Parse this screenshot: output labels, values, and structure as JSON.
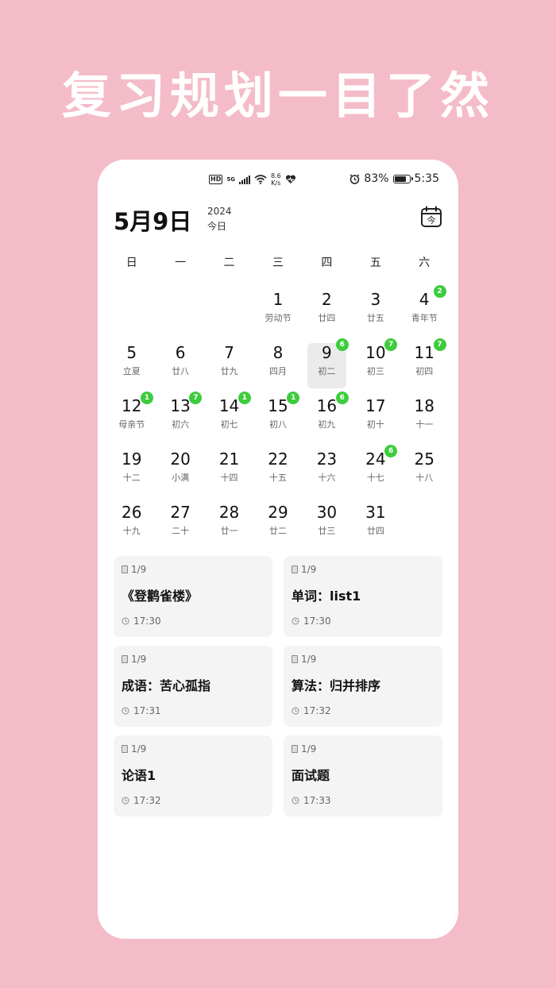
{
  "headline": "复习规划一目了然",
  "status_bar": {
    "hd": "HD",
    "net": "5G",
    "speed_value": "8.6",
    "speed_unit": "K/s",
    "battery_percent": "83%",
    "battery_level": 0.83,
    "time": "5:35"
  },
  "header": {
    "date": "5月9日",
    "year": "2024",
    "today_label": "今日",
    "today_button_glyph": "今"
  },
  "weekdays": [
    "日",
    "一",
    "二",
    "三",
    "四",
    "五",
    "六"
  ],
  "days": [
    {
      "num": "",
      "sub": "",
      "badge": ""
    },
    {
      "num": "",
      "sub": "",
      "badge": ""
    },
    {
      "num": "",
      "sub": "",
      "badge": ""
    },
    {
      "num": "1",
      "sub": "劳动节",
      "badge": ""
    },
    {
      "num": "2",
      "sub": "廿四",
      "badge": ""
    },
    {
      "num": "3",
      "sub": "廿五",
      "badge": ""
    },
    {
      "num": "4",
      "sub": "青年节",
      "badge": "2"
    },
    {
      "num": "5",
      "sub": "立夏",
      "badge": ""
    },
    {
      "num": "6",
      "sub": "廿八",
      "badge": ""
    },
    {
      "num": "7",
      "sub": "廿九",
      "badge": ""
    },
    {
      "num": "8",
      "sub": "四月",
      "badge": ""
    },
    {
      "num": "9",
      "sub": "初二",
      "badge": "6",
      "selected": true
    },
    {
      "num": "10",
      "sub": "初三",
      "badge": "7"
    },
    {
      "num": "11",
      "sub": "初四",
      "badge": "7"
    },
    {
      "num": "12",
      "sub": "母亲节",
      "badge": "1"
    },
    {
      "num": "13",
      "sub": "初六",
      "badge": "7"
    },
    {
      "num": "14",
      "sub": "初七",
      "badge": "1"
    },
    {
      "num": "15",
      "sub": "初八",
      "badge": "1"
    },
    {
      "num": "16",
      "sub": "初九",
      "badge": "6"
    },
    {
      "num": "17",
      "sub": "初十",
      "badge": ""
    },
    {
      "num": "18",
      "sub": "十一",
      "badge": ""
    },
    {
      "num": "19",
      "sub": "十二",
      "badge": ""
    },
    {
      "num": "20",
      "sub": "小满",
      "badge": ""
    },
    {
      "num": "21",
      "sub": "十四",
      "badge": ""
    },
    {
      "num": "22",
      "sub": "十五",
      "badge": ""
    },
    {
      "num": "23",
      "sub": "十六",
      "badge": ""
    },
    {
      "num": "24",
      "sub": "十七",
      "badge": "6"
    },
    {
      "num": "25",
      "sub": "十八",
      "badge": ""
    },
    {
      "num": "26",
      "sub": "十九",
      "badge": ""
    },
    {
      "num": "27",
      "sub": "二十",
      "badge": ""
    },
    {
      "num": "28",
      "sub": "廿一",
      "badge": ""
    },
    {
      "num": "29",
      "sub": "廿二",
      "badge": ""
    },
    {
      "num": "30",
      "sub": "廿三",
      "badge": ""
    },
    {
      "num": "31",
      "sub": "廿四",
      "badge": ""
    }
  ],
  "cards": [
    {
      "count": "1/9",
      "title": "《登鹳雀楼》",
      "time": "17:30"
    },
    {
      "count": "1/9",
      "title": "单词：list1",
      "time": "17:30"
    },
    {
      "count": "1/9",
      "title": "成语：苦心孤指",
      "time": "17:31"
    },
    {
      "count": "1/9",
      "title": "算法：归并排序",
      "time": "17:32"
    },
    {
      "count": "1/9",
      "title": "论语1",
      "time": "17:32"
    },
    {
      "count": "1/9",
      "title": "面试题",
      "time": "17:33"
    }
  ],
  "colors": {
    "background": "#f4bcc8",
    "badge": "#3dcc3d",
    "selected_day": "#ebebeb",
    "card": "#f4f4f4"
  }
}
